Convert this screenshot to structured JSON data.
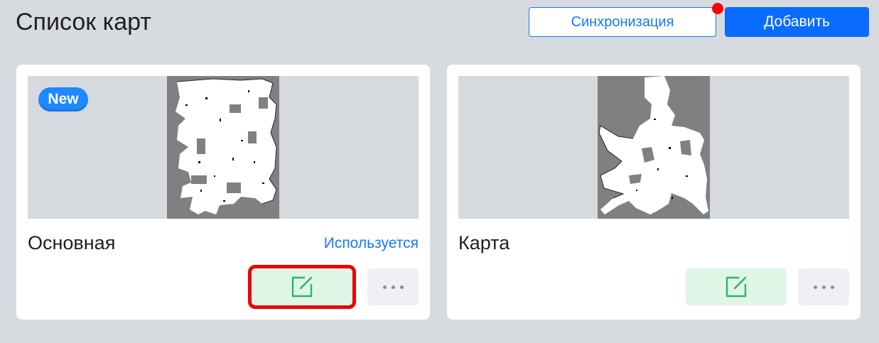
{
  "header": {
    "title": "Список карт",
    "sync_label": "Синхронизация",
    "add_label": "Добавить"
  },
  "cards": [
    {
      "name": "Основная",
      "badge": "New",
      "status": "Используется",
      "edit_icon": "edit-icon",
      "more_icon": "more-icon"
    },
    {
      "name": "Карта",
      "edit_icon": "edit-icon",
      "more_icon": "more-icon"
    }
  ],
  "colors": {
    "accent": "#1677ff",
    "notification": "#ff0000",
    "edit_bg": "#dff5e6",
    "edit_icon": "#2db36b",
    "highlight": "#ee0000"
  }
}
